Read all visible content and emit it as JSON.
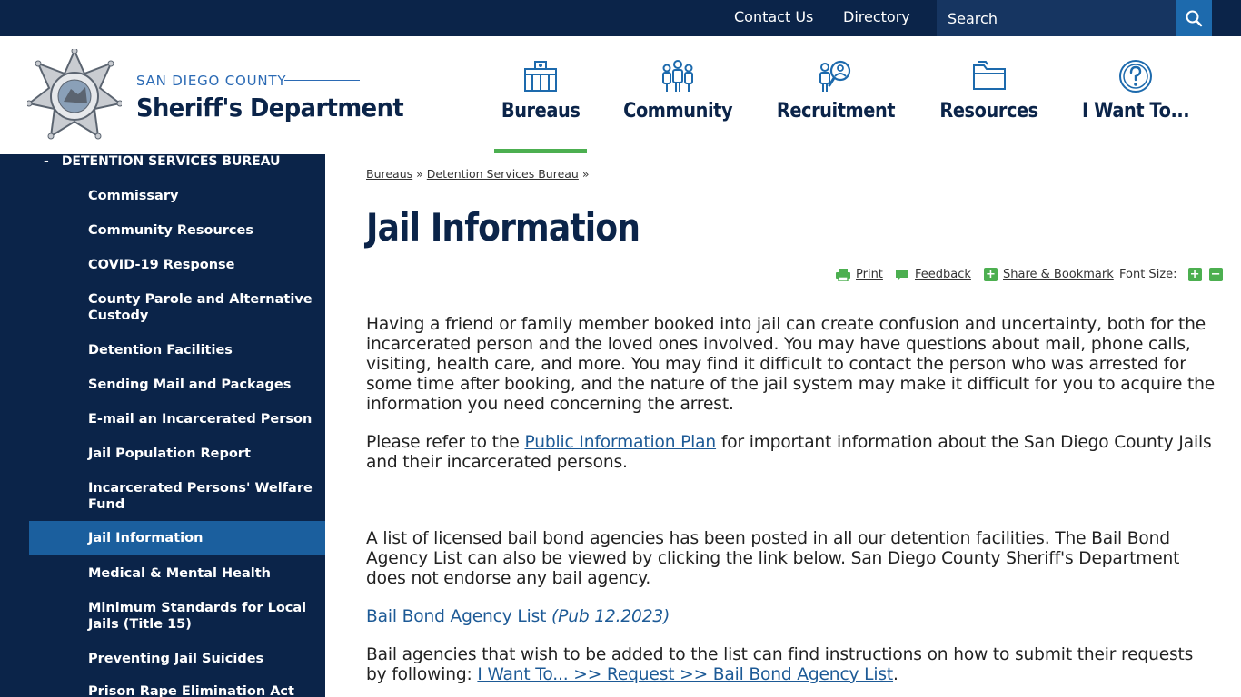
{
  "topbar": {
    "contact_label": "Contact Us",
    "directory_label": "Directory",
    "search_placeholder": "Search"
  },
  "header": {
    "county": "SAN DIEGO COUNTY",
    "department": "Sheriff's Department",
    "nav": [
      {
        "label": "Bureaus",
        "icon": "building-icon"
      },
      {
        "label": "Community",
        "icon": "people-icon"
      },
      {
        "label": "Recruitment",
        "icon": "recruit-search-icon"
      },
      {
        "label": "Resources",
        "icon": "folder-icon"
      },
      {
        "label": "I Want To...",
        "icon": "question-icon"
      }
    ],
    "active_nav": "Bureaus"
  },
  "sidebar": {
    "parent_label": "DETENTION SERVICES BUREAU",
    "parent_marker": "-",
    "items": [
      {
        "label": "Commissary"
      },
      {
        "label": "Community Resources"
      },
      {
        "label": "COVID-19 Response"
      },
      {
        "label": "County Parole and Alternative Custody"
      },
      {
        "label": "Detention Facilities"
      },
      {
        "label": "Sending Mail and Packages"
      },
      {
        "label": "E-mail an Incarcerated Person"
      },
      {
        "label": "Jail Population Report"
      },
      {
        "label": "Incarcerated Persons' Welfare Fund"
      },
      {
        "label": "Jail Information"
      },
      {
        "label": "Medical & Mental Health"
      },
      {
        "label": "Minimum Standards for Local Jails (Title 15)"
      },
      {
        "label": "Preventing Jail Suicides"
      },
      {
        "label": "Prison Rape Elimination Act"
      }
    ],
    "active_item": "Jail Information"
  },
  "breadcrumb": {
    "items": [
      "Bureaus",
      "Detention Services Bureau"
    ],
    "separator": "»"
  },
  "main": {
    "title": "Jail Information",
    "tools": {
      "print": "Print",
      "feedback": "Feedback",
      "share": "Share & Bookmark",
      "font_size": "Font Size:"
    },
    "p1": "Having a friend or family member booked into jail can create confusion and uncertainty, both for the incarcerated person and the loved ones involved. You may have questions about mail, phone calls, visiting, health care, and more. You may find it difficult to contact the person who was arrested for some time after booking, and the nature of the jail system may make it difficult for you to acquire the information you need concerning the arrest.",
    "p2_before": "Please refer to the ",
    "p2_link": "Public Information Plan",
    "p2_after": " for important information about the San Diego County Jails and their incarcerated persons.",
    "p3": "A list of licensed bail bond agencies has been posted in all our detention facilities. The Bail Bond Agency List can also be viewed by clicking the link below. San Diego County Sheriff's Department does not endorse any bail agency.",
    "bail_link": "Bail Bond Agency List ",
    "bail_link_pub": "(Pub 12.2023)",
    "p5_before": "Bail agencies that wish to be added to the list can find instructions on how to submit their requests by following: ",
    "p5_link": "I Want To... >> Request >> Bail Bond Agency List",
    "p5_after": "."
  }
}
